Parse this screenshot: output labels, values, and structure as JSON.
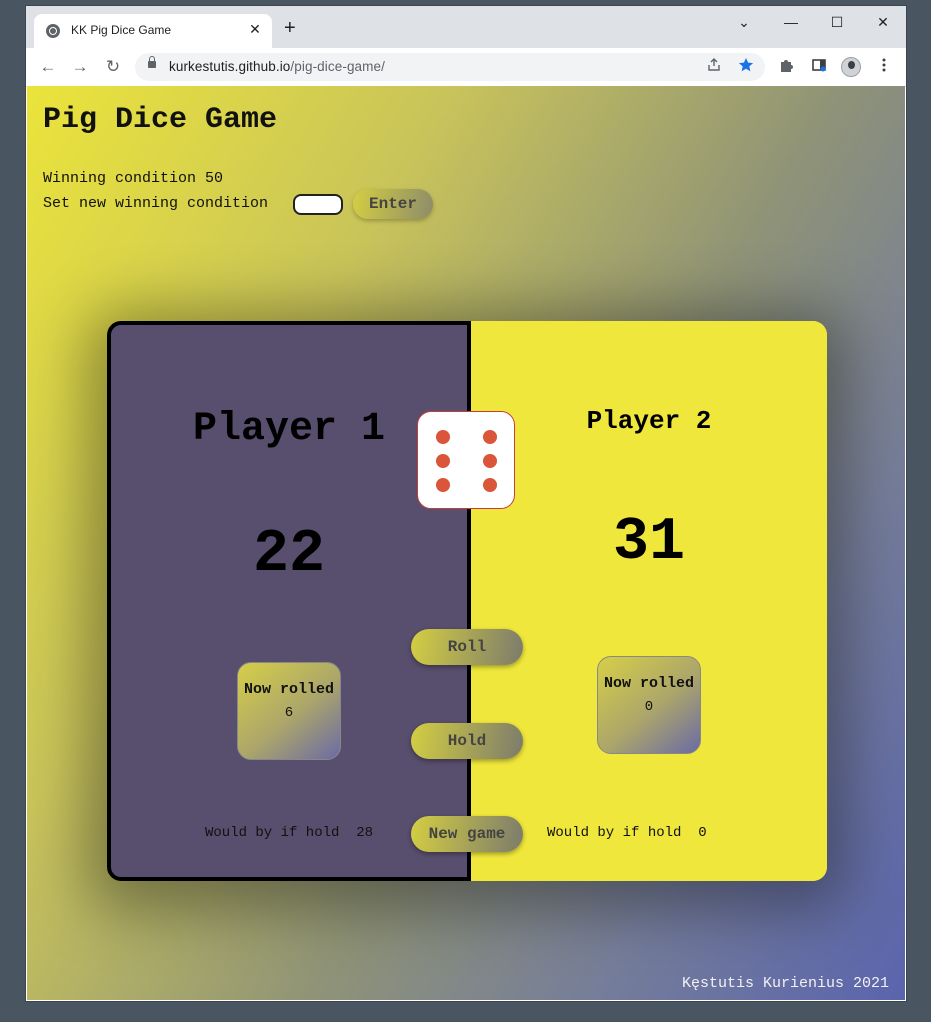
{
  "browser": {
    "tab_title": "KK Pig Dice Game",
    "tab_close": "✕",
    "new_tab": "+",
    "url_host": "kurkestutis.github.io",
    "url_path": "/pig-dice-game/",
    "controls": {
      "tab_search": "⌄",
      "minimize": "—",
      "maximize": "☐",
      "close": "✕"
    },
    "nav": {
      "back": "←",
      "forward": "→",
      "reload": "↻"
    },
    "icons": [
      "globe-icon",
      "lock-icon",
      "share-icon",
      "star-icon",
      "puzzle-icon",
      "sidepanel-icon",
      "avatar",
      "menu-icon"
    ]
  },
  "page": {
    "title": "Pig Dice Game",
    "winning_condition": "Winning condition 50",
    "set_new_label": "Set new winning condition",
    "winning_input_value": "",
    "enter_label": "Enter"
  },
  "game": {
    "player1": {
      "name": "Player 1",
      "score": "22",
      "now_rolled_label": "Now rolled",
      "now_rolled": "6",
      "would_hold": "Would by if hold  28"
    },
    "player2": {
      "name": "Player 2",
      "score": "31",
      "now_rolled_label": "Now rolled",
      "now_rolled": "0",
      "would_hold": "Would by if hold  0"
    },
    "dice_value": 6,
    "roll_label": "Roll",
    "hold_label": "Hold",
    "new_game_label": "New game",
    "active_player": 1
  },
  "footer": "Kęstutis Kurienius 2021",
  "colors": {
    "player1_bg": "#584e6d",
    "player2_bg": "#efe73b",
    "dice_pip": "#d9563a",
    "star_active": "#1a73e8"
  }
}
